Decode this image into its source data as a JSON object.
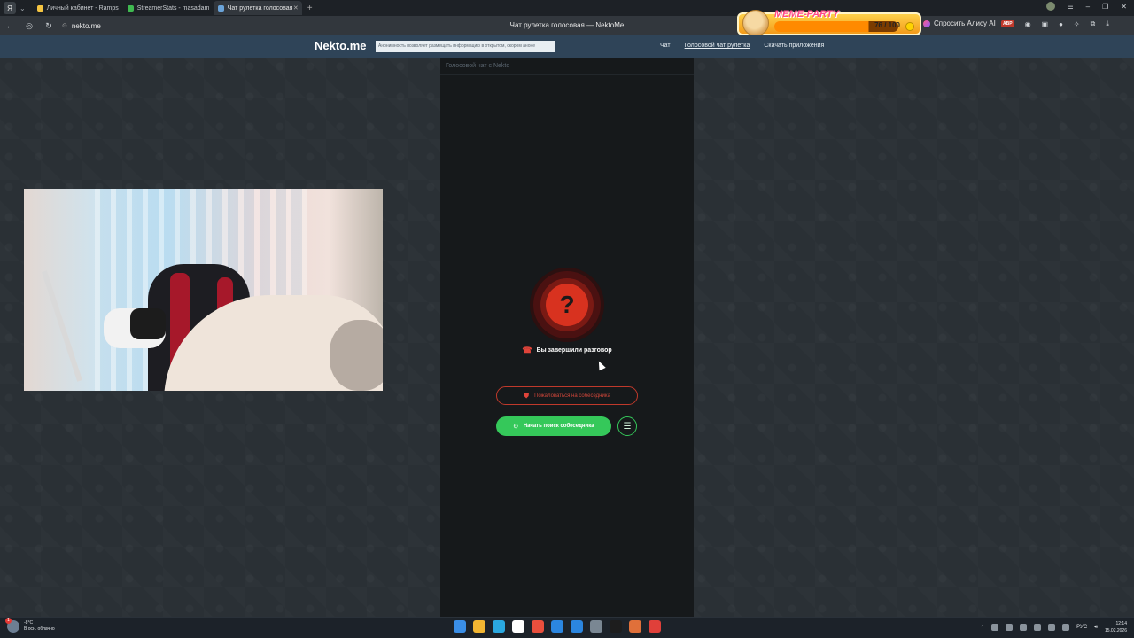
{
  "browser": {
    "logo": "Я",
    "tabs": [
      {
        "label": "Личный кабинет - Ramps",
        "favicon_color": "#f5c542"
      },
      {
        "label": "StreamerStats - masadam",
        "favicon_color": "#3fb950"
      },
      {
        "label": "Чат рулетка голосовая",
        "favicon_color": "#6aa3d8",
        "active": true
      }
    ],
    "url": "nekto.me",
    "page_title": "Чат рулетка голосовая — NektoMe",
    "meme_party": {
      "title": "MEME-PARTY",
      "score": "76 / 100",
      "progress": 0.76
    },
    "alice_label": "Спросить Алису AI",
    "abp_label": "ABP"
  },
  "site": {
    "logo": "Nekto.me",
    "notice": "Анонимность позволяет размещать информацию в открытом, скором аноне",
    "nav": [
      {
        "label": "Чат",
        "current": false
      },
      {
        "label": "Голосовой чат рулетка",
        "current": true
      },
      {
        "label": "Скачать приложения",
        "current": false
      }
    ]
  },
  "panel": {
    "title": "Голосовой чат с Nekto",
    "status_icon": "?",
    "ended_text": "Вы завершили разговор",
    "report_label": "Пожаловаться на собеседника",
    "search_label": "Начать поиск собеседника"
  },
  "taskbar": {
    "weather_badge": "1",
    "temperature": "-8°C",
    "weather_desc": "В осн. облачно",
    "lang": "РУС",
    "time": "12:14",
    "date": "15.02.2026",
    "apps": [
      "#3a8ee6",
      "#f2b632",
      "#2aa8e0",
      "#ffffff",
      "#e94f3d",
      "#2b86e0",
      "#2b86e0",
      "#7a8793",
      "#1d1d1d",
      "#e0703a",
      "#e0403a"
    ]
  },
  "colors": {
    "accent_green": "#35c85a",
    "danger_red": "#d8321f",
    "header_blue": "#2f4458"
  }
}
